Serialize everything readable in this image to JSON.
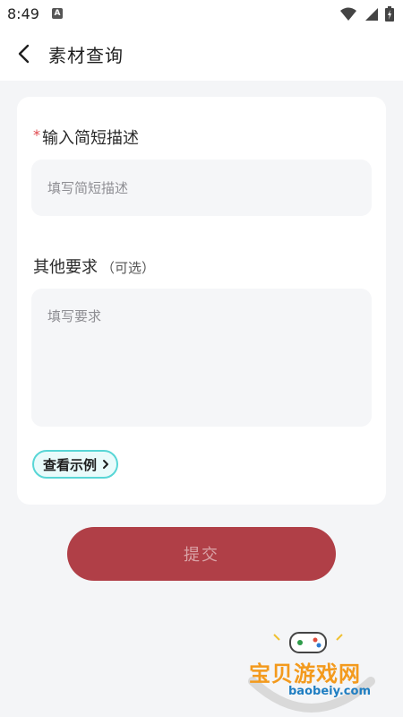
{
  "status_bar": {
    "time": "8:49",
    "app_icon_letter": "A"
  },
  "header": {
    "title": "素材查询"
  },
  "form": {
    "description": {
      "required_mark": "*",
      "label": "输入简短描述",
      "placeholder": "填写简短描述",
      "value": ""
    },
    "other": {
      "label": "其他要求",
      "optional_note": "（可选）",
      "placeholder": "填写要求",
      "value": ""
    },
    "example_button": "查看示例"
  },
  "submit": {
    "label": "提交"
  },
  "watermark": {
    "text": "宝贝游戏网",
    "url": "baobeiy.com"
  },
  "colors": {
    "accent": "#b03f47",
    "example_border": "#58d6d6",
    "required": "#e0474c",
    "watermark_orange": "#f39a1d"
  }
}
